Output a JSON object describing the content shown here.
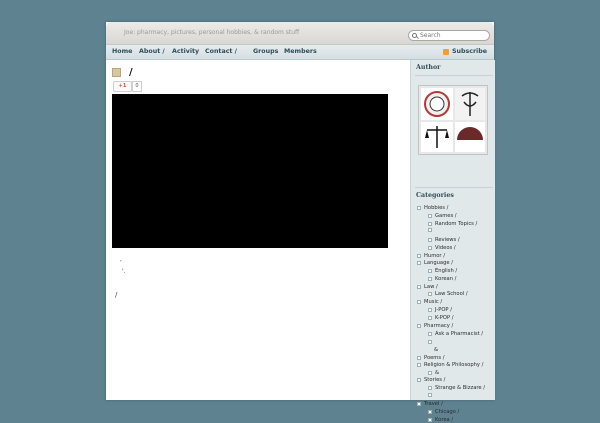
{
  "header": {
    "tagline": "Joe: pharmacy, pictures, personal hobbies, & random stuff",
    "search_placeholder": "Search"
  },
  "nav": {
    "items": [
      "Home",
      "About /",
      "Activity",
      "Contact /",
      "Groups",
      "Members"
    ],
    "subscribe": "Subscribe"
  },
  "post": {
    "title": "/",
    "gplus_label": "+1",
    "gplus_count": "0",
    "text_lines": [
      ",",
      "'.",
      "/"
    ]
  },
  "sidebar": {
    "author_heading": "Author",
    "categories_heading": "Categories",
    "categories": [
      "Hobbies /",
      "Games /",
      "Random Topics /",
      "",
      "Reviews /",
      "Videos /",
      "Humor /",
      "Language /",
      "English /",
      "Korean /",
      "Law /",
      "Law School /",
      "Music /",
      "J-POP /",
      "K-POP /",
      "Pharmacy /",
      "Ask a Pharmacist /",
      "",
      "&",
      "Poems /",
      "Religion & Philosophy /",
      "&",
      "Stories /",
      "Strange & Bizzare /",
      "",
      "Travel /",
      "Chicago /",
      "Korea /"
    ]
  },
  "colors": {
    "background": "#5f8290",
    "nav_text": "#2f4c57",
    "rss": "#f39c33"
  }
}
